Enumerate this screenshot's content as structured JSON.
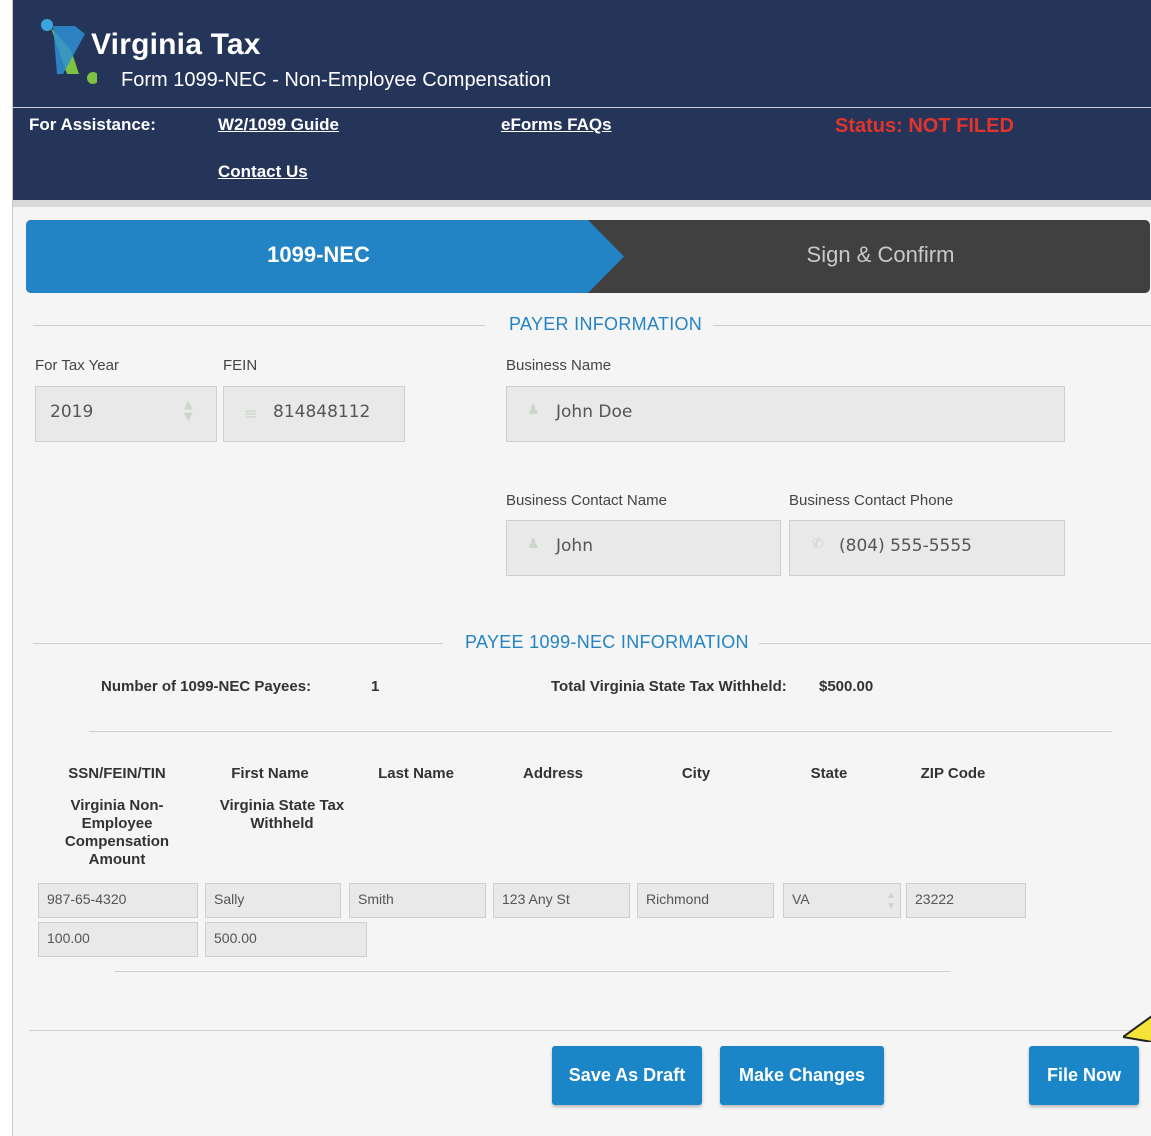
{
  "header": {
    "brand": "Virginia Tax",
    "form_title": "Form 1099-NEC - Non-Employee Compensation",
    "assistance_label": "For Assistance:",
    "links": {
      "guide": "W2/1099 Guide",
      "faqs": "eForms FAQs",
      "contact": "Contact Us"
    },
    "status": "Status: NOT FILED"
  },
  "steps": [
    {
      "label": "1099-NEC",
      "active": true
    },
    {
      "label": "Sign & Confirm",
      "active": false
    }
  ],
  "payer": {
    "section_title": "PAYER INFORMATION",
    "tax_year_label": "For Tax Year",
    "tax_year": "2019",
    "fein_label": "FEIN",
    "fein": "814848112",
    "business_name_label": "Business Name",
    "business_name": "John Doe",
    "contact_name_label": "Business Contact Name",
    "contact_name": "John",
    "contact_phone_label": "Business Contact Phone",
    "contact_phone": "(804) 555-5555"
  },
  "payee": {
    "section_title": "PAYEE 1099-NEC INFORMATION",
    "count_label": "Number of 1099-NEC Payees:",
    "count": "1",
    "withheld_label": "Total Virginia State Tax Withheld:",
    "withheld": "$500.00",
    "columns": {
      "ssn": "SSN/FEIN/TIN",
      "first": "First Name",
      "last": "Last Name",
      "address": "Address",
      "city": "City",
      "state": "State",
      "zip": "ZIP Code",
      "comp": "Virginia Non-Employee Compensation Amount",
      "withheld": "Virginia State Tax Withheld"
    },
    "row": {
      "ssn": "987-65-4320",
      "first": "Sally",
      "last": "Smith",
      "address": "123 Any St",
      "city": "Richmond",
      "state": "VA",
      "zip": "23222",
      "comp": "100.00",
      "withheld": "500.00"
    }
  },
  "buttons": {
    "save_draft": "Save As Draft",
    "make_changes": "Make Changes",
    "file_now": "File Now"
  },
  "colors": {
    "header_bg": "#253459",
    "accent": "#1a86c8",
    "status_red": "#e0342c",
    "step_inactive": "#404040"
  },
  "icons": {
    "year_spinner": "up-down-arrows-icon",
    "fein": "hamburger-icon",
    "person": "person-icon",
    "phone": "phone-icon"
  }
}
